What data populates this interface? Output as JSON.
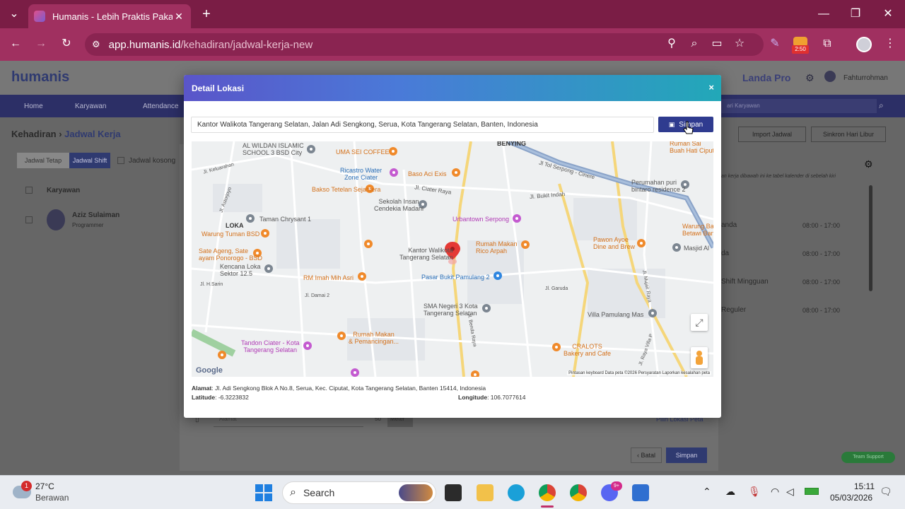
{
  "browser": {
    "tab_title": "Humanis - Lebih Praktis Pakai H",
    "url_host": "app.humanis.id",
    "url_path": "/kehadiran/jadwal-kerja-new",
    "timer_badge": "2:50"
  },
  "app": {
    "logo": "humanis",
    "plan": "Landa Pro",
    "user": "Fahturrohman",
    "nav": [
      "Home",
      "Karyawan",
      "Attendance"
    ],
    "search_placeholder": "ari Karyawan",
    "breadcrumb_root": "Kehadiran",
    "breadcrumb_current": "Jadwal Kerja",
    "tabs": [
      "Jadwal Tetap",
      "Jadwal Shift"
    ],
    "empty_check": "Jadwal kosong",
    "col_employee": "Karyawan",
    "employee_name": "Aziz Sulaiman",
    "employee_role": "Programmer",
    "import_btn": "Import Jadwal",
    "sync_btn": "Sinkron Hari Libur",
    "hint": "an kerja dibawah ini ke tabel kalender di sebelah kiri",
    "schedule": [
      {
        "name": "anda",
        "time": "08:00 - 17:00"
      },
      {
        "name": "da",
        "time": "08:00 - 17:00"
      },
      {
        "name": "Shift Mingguan",
        "time": "08:00 - 17:00"
      },
      {
        "name": "Reguler",
        "time": "08:00 - 17:00"
      }
    ],
    "form_address_placeholder": "Alamat",
    "form_radius": "50",
    "form_unit": "Meter",
    "pick_map": "Pilih Lokasi Peta",
    "cancel": "Batal",
    "save": "Simpan",
    "support": "Team Support"
  },
  "modal": {
    "title": "Detail Lokasi",
    "close": "×",
    "search_value": "Kantor Walikota Tangerang Selatan, Jalan Adi Sengkong, Serua, Kota Tangerang Selatan, Banten, Indonesia",
    "save_label": "Simpan",
    "address_label": "Alamat",
    "address_value": ": Jl. Adi Sengkong Blok A No.8, Serua, Kec. Ciputat, Kota Tangerang Selatan, Banten 15414, Indonesia",
    "lat_label": "Latitude",
    "lat_value": ": -6.3223832",
    "lng_label": "Longitude",
    "lng_value": ": 106.7077614"
  },
  "map": {
    "labels": [
      {
        "id": "al-wildan",
        "text": "AL WILDAN ISLAMIC",
        "text2": "SCHOOL 3 BSD City",
        "cls": "g"
      },
      {
        "id": "uma-sei",
        "text": "UMA SEI COFFEE",
        "cls": "o"
      },
      {
        "id": "bening",
        "text": "BENYING",
        "cls": "d"
      },
      {
        "id": "ruman-sai",
        "text": "Ruman Sai",
        "text2": "Buah Hati Ciputr",
        "cls": "o"
      },
      {
        "id": "ricastro",
        "text": "Ricastro Water",
        "text2": "Zone Ciater",
        "cls": "b"
      },
      {
        "id": "baso-aci",
        "text": "Baso Aci Exis",
        "cls": "o"
      },
      {
        "id": "bakso-tetelan",
        "text": "Bakso Tetelan Sejahtera",
        "cls": "o"
      },
      {
        "id": "sekolah-insan",
        "text": "Sekolah Insan",
        "text2": "Cendekia Madani",
        "cls": "g"
      },
      {
        "id": "perumahan",
        "text": "Perumahan puri",
        "text2": "bintaro residence 2",
        "cls": "g"
      },
      {
        "id": "taman-chrysant",
        "text": "Taman Chrysant 1",
        "cls": "g"
      },
      {
        "id": "loka",
        "text": "LOKA",
        "cls": "d"
      },
      {
        "id": "urbantown",
        "text": "Urbantown Serpong",
        "cls": "p"
      },
      {
        "id": "warung-tuman",
        "text": "Warung Tuman BSD",
        "cls": "o"
      },
      {
        "id": "warung-ba",
        "text": "Warung Ba",
        "text2": "Betawi Bang Jo",
        "cls": "o"
      },
      {
        "id": "rumah-makan-rico",
        "text": "Rumah Makan",
        "text2": "Rico Arpah",
        "cls": "o"
      },
      {
        "id": "pawon-ayoe",
        "text": "Pawon Ayoe",
        "text2": "Dine and Brew",
        "cls": "o"
      },
      {
        "id": "masjid-al",
        "text": "Masjid Al",
        "cls": "g"
      },
      {
        "id": "kantor-walikota",
        "text": "Kantor Walikota",
        "text2": "Tangerang Selatan",
        "cls": "g"
      },
      {
        "id": "sate-ageng",
        "text": "Sate Ageng, Sate",
        "text2": "ayam Ponorogo - BSD",
        "cls": "o"
      },
      {
        "id": "kencana-loka",
        "text": "Kencana Loka",
        "text2": "Sektor 12.5",
        "cls": "g"
      },
      {
        "id": "rm-imah",
        "text": "RM Imah Mih Asri",
        "cls": "o"
      },
      {
        "id": "pasar-bukit",
        "text": "Pasar Bukit Pamulang 2",
        "cls": "b"
      },
      {
        "id": "sma-negeri",
        "text": "SMA Negeri 3 Kota",
        "text2": "Tangerang Selatan",
        "cls": "g"
      },
      {
        "id": "villa-pamulang",
        "text": "Villa Pamulang Mas",
        "cls": "g"
      },
      {
        "id": "tandon",
        "text": "Tandon Ciater - Kota",
        "text2": "Tangerang Selatan",
        "cls": "p"
      },
      {
        "id": "rumah-makan-pemancingan",
        "text": "Rumah Makan",
        "text2": "& Pemancingan...",
        "cls": "o"
      },
      {
        "id": "cralots",
        "text": "CRALOTS",
        "text2": "Bakery and Cafe",
        "cls": "o"
      }
    ],
    "roads": [
      "Jl. Keluarahan",
      "Jl. Astorjoyo",
      "Jl. Ciater Raya",
      "Jl. Bukit Indah",
      "Jl Tol Serpong - Cinere",
      "Jl. H.Sarin",
      "Jl. Damai 2",
      "Jl. Garuda",
      "Jl. Benda Raya",
      "Jl. Mujair Raya",
      "Jl. Raya Villa P"
    ],
    "google": "Google",
    "attrib": "Pintasan keyboard   Data peta ©2026   Persyaratan   Laporkan kesalahan peta"
  },
  "taskbar": {
    "weather_temp": "27°C",
    "weather_desc": "Berawan",
    "weather_badge": "1",
    "search": "Search",
    "time": "15:11",
    "date": "05/03/2026",
    "discord_badge": "9+"
  },
  "colors": {
    "chrome_dark": "#7a1d45",
    "chrome": "#a03060",
    "modal_btn": "#2f3b8f",
    "nav": "#2c2f66"
  }
}
